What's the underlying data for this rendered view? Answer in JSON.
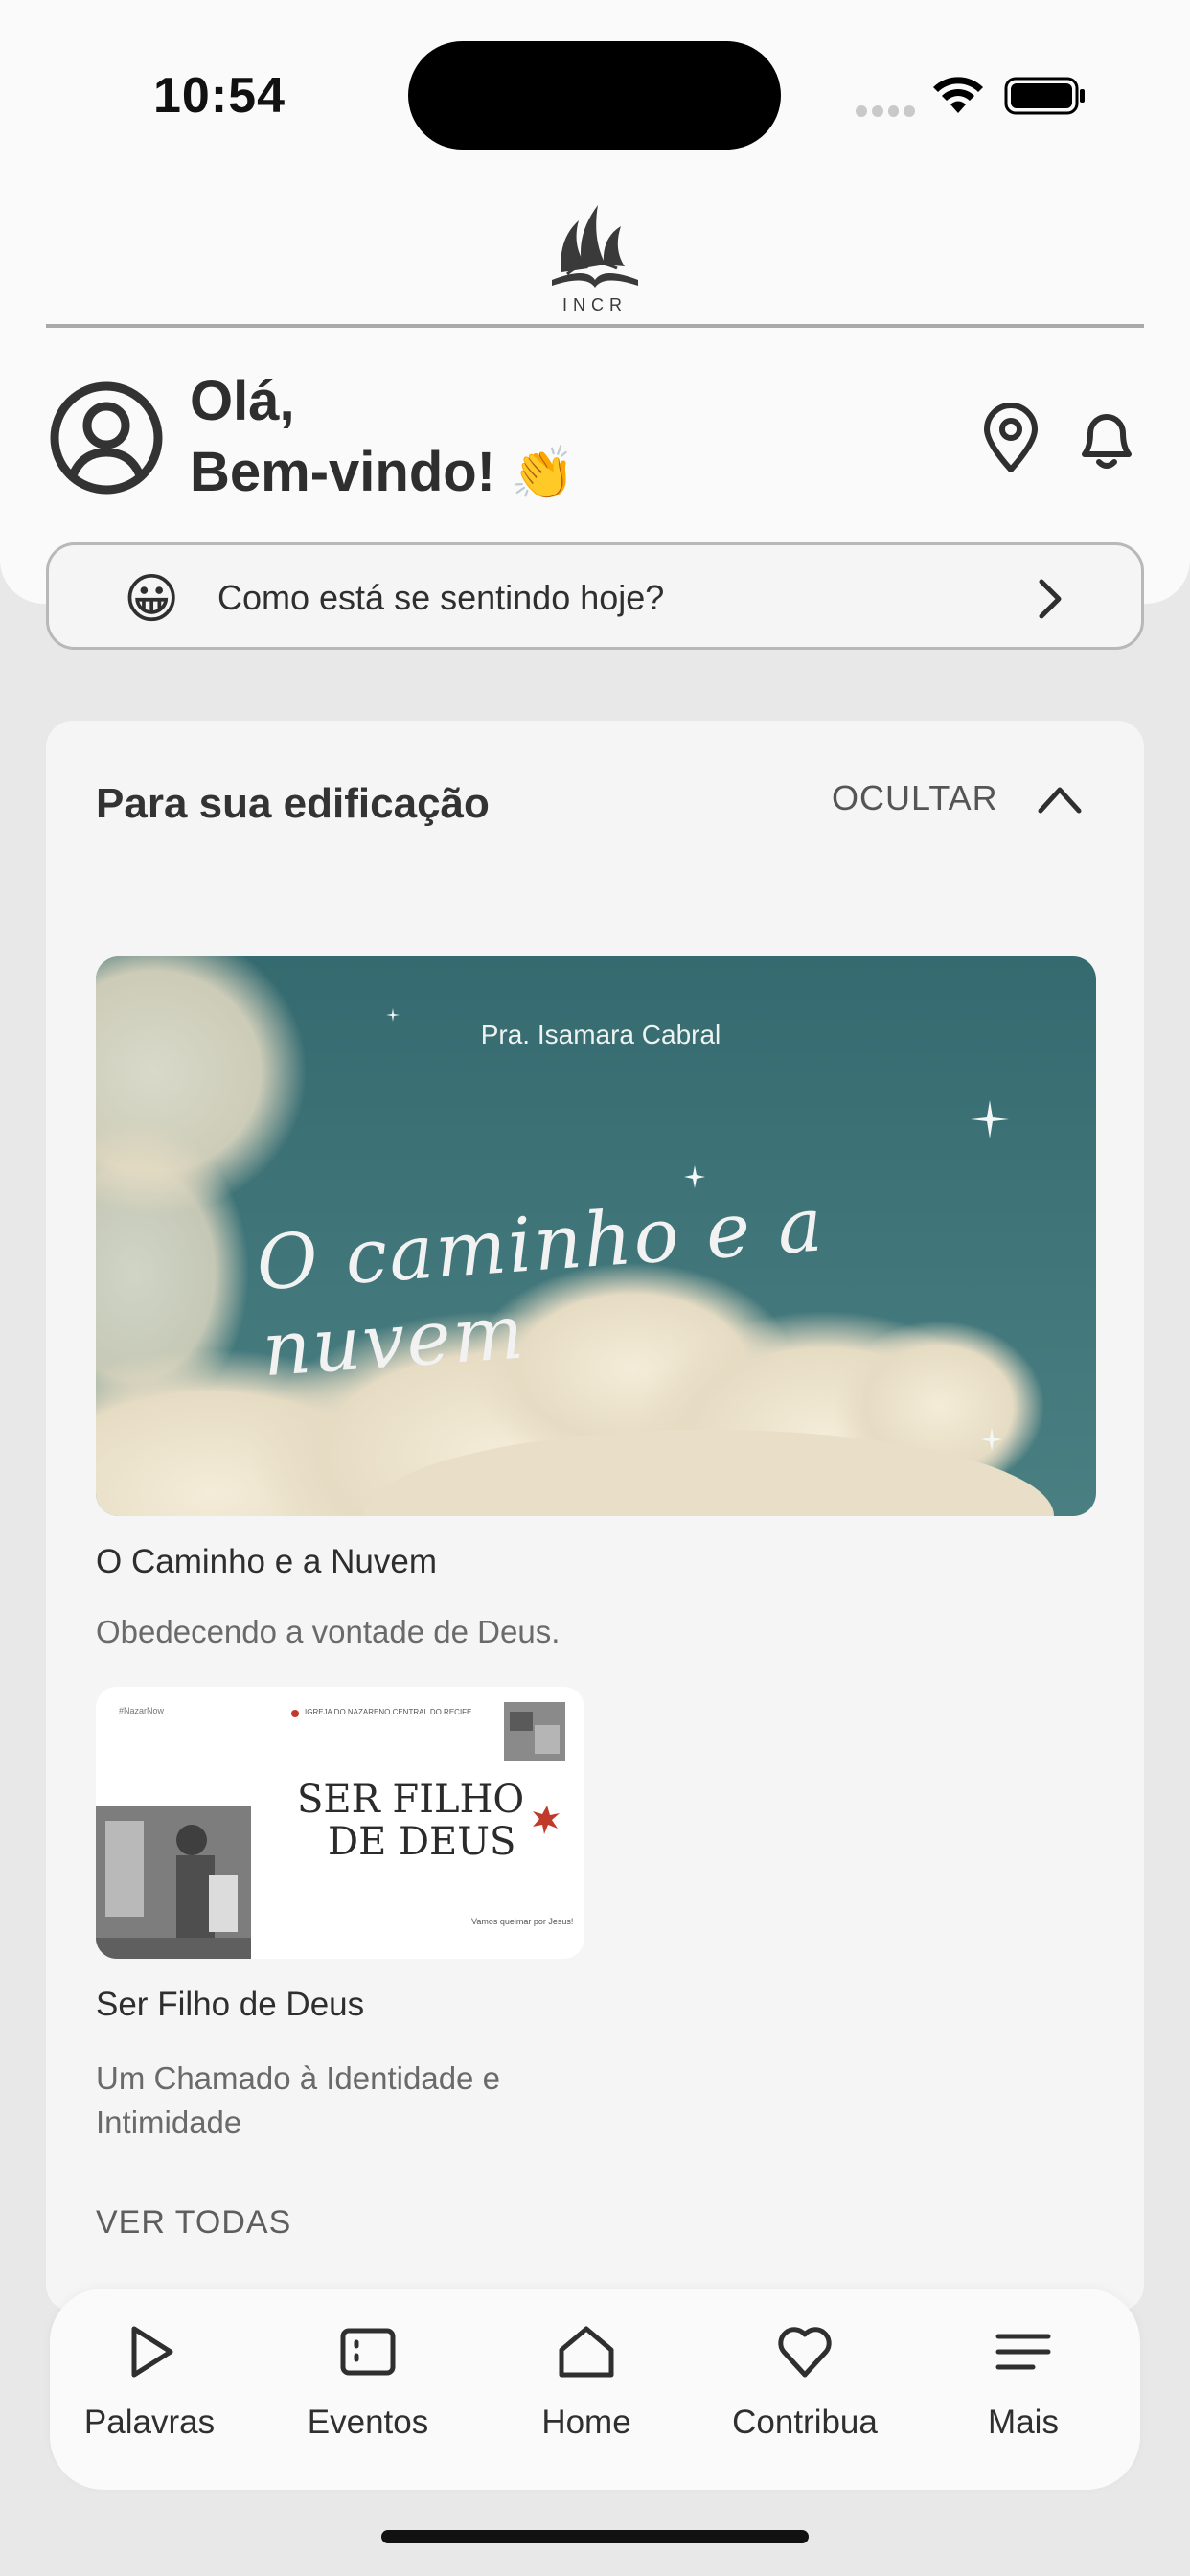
{
  "status_bar": {
    "time": "10:54"
  },
  "header": {
    "logo_text": "INCR",
    "greeting_line1": "Olá,",
    "greeting_line2": "Bem-vindo!",
    "greeting_emoji": "👏"
  },
  "mood": {
    "emoji": "😀",
    "prompt": "Como está se sentindo hoje?"
  },
  "edification": {
    "title": "Para sua edificação",
    "hide_label": "OCULTAR",
    "items": [
      {
        "image_author": "Pra. Isamara Cabral",
        "image_title": "O caminho e a nuvem",
        "title": "O Caminho e a Nuvem",
        "subtitle": "Obedecendo a vontade de Deus."
      },
      {
        "image_tag": "#NazarNow",
        "image_church": "IGREJA DO NAZARENO CENTRAL DO RECIFE",
        "image_title_line1": "SER FILHO",
        "image_title_line2": "DE DEUS",
        "image_footer": "Vamos queimar por Jesus!",
        "title": "Ser Filho de Deus",
        "subtitle": "Um Chamado à Identidade e Intimidade"
      }
    ],
    "see_all_label": "VER TODAS"
  },
  "tabbar": {
    "tabs": [
      {
        "label": "Palavras",
        "icon": "play-icon"
      },
      {
        "label": "Eventos",
        "icon": "events-icon"
      },
      {
        "label": "Home",
        "icon": "home-icon"
      },
      {
        "label": "Contribua",
        "icon": "heart-icon"
      },
      {
        "label": "Mais",
        "icon": "menu-icon"
      }
    ]
  },
  "colors": {
    "background": "#e8e8e8",
    "surface": "#fafafa",
    "card": "#f5f5f5",
    "text": "#2f2f2f",
    "feature_sky": "#3f7478"
  }
}
